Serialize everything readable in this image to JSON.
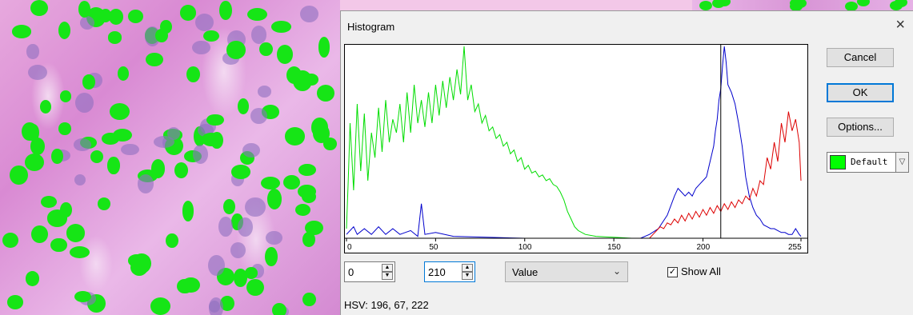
{
  "dialog": {
    "title": "Histogram",
    "close_glyph": "×"
  },
  "buttons": {
    "cancel": "Cancel",
    "ok": "OK",
    "options": "Options..."
  },
  "color_select": {
    "value": "Default",
    "swatch_color": "#00ff00"
  },
  "controls": {
    "low_value": "0",
    "high_value": "210",
    "channel": "Value",
    "show_all_label": "Show All",
    "show_all_checked": true
  },
  "status": {
    "text": "HSV: 196, 67, 222"
  },
  "chart_data": {
    "type": "line",
    "x_ticks": [
      "0",
      "50",
      "100",
      "150",
      "200",
      "255"
    ],
    "xlim": [
      0,
      255
    ],
    "ylim": [
      0,
      1
    ],
    "threshold_value": 210,
    "series": [
      {
        "color": "#00dd00",
        "points": [
          [
            0,
            0.05
          ],
          [
            1,
            0.3
          ],
          [
            2,
            0.6
          ],
          [
            4,
            0.25
          ],
          [
            6,
            0.7
          ],
          [
            8,
            0.35
          ],
          [
            10,
            0.65
          ],
          [
            12,
            0.3
          ],
          [
            14,
            0.55
          ],
          [
            16,
            0.42
          ],
          [
            18,
            0.68
          ],
          [
            20,
            0.45
          ],
          [
            22,
            0.72
          ],
          [
            24,
            0.5
          ],
          [
            26,
            0.62
          ],
          [
            28,
            0.55
          ],
          [
            30,
            0.7
          ],
          [
            32,
            0.5
          ],
          [
            34,
            0.76
          ],
          [
            36,
            0.55
          ],
          [
            38,
            0.8
          ],
          [
            40,
            0.6
          ],
          [
            42,
            0.72
          ],
          [
            44,
            0.58
          ],
          [
            46,
            0.76
          ],
          [
            48,
            0.6
          ],
          [
            50,
            0.8
          ],
          [
            52,
            0.64
          ],
          [
            54,
            0.82
          ],
          [
            56,
            0.68
          ],
          [
            58,
            0.84
          ],
          [
            60,
            0.72
          ],
          [
            62,
            0.88
          ],
          [
            64,
            0.75
          ],
          [
            66,
            1.0
          ],
          [
            68,
            0.72
          ],
          [
            70,
            0.8
          ],
          [
            72,
            0.66
          ],
          [
            74,
            0.7
          ],
          [
            76,
            0.6
          ],
          [
            78,
            0.64
          ],
          [
            80,
            0.56
          ],
          [
            82,
            0.58
          ],
          [
            84,
            0.52
          ],
          [
            86,
            0.54
          ],
          [
            88,
            0.48
          ],
          [
            90,
            0.5
          ],
          [
            92,
            0.44
          ],
          [
            94,
            0.46
          ],
          [
            96,
            0.4
          ],
          [
            98,
            0.42
          ],
          [
            100,
            0.36
          ],
          [
            102,
            0.38
          ],
          [
            104,
            0.34
          ],
          [
            106,
            0.35
          ],
          [
            108,
            0.32
          ],
          [
            110,
            0.33
          ],
          [
            112,
            0.3
          ],
          [
            114,
            0.31
          ],
          [
            116,
            0.28
          ],
          [
            118,
            0.27
          ],
          [
            120,
            0.24
          ],
          [
            122,
            0.2
          ],
          [
            124,
            0.14
          ],
          [
            126,
            0.1
          ],
          [
            128,
            0.06
          ],
          [
            130,
            0.04
          ],
          [
            134,
            0.02
          ],
          [
            140,
            0.01
          ],
          [
            150,
            0.005
          ],
          [
            160,
            0.0
          ],
          [
            255,
            0.0
          ]
        ]
      },
      {
        "color": "#0000cc",
        "points": [
          [
            0,
            0.02
          ],
          [
            4,
            0.06
          ],
          [
            6,
            0.02
          ],
          [
            10,
            0.05
          ],
          [
            14,
            0.02
          ],
          [
            18,
            0.06
          ],
          [
            22,
            0.02
          ],
          [
            26,
            0.05
          ],
          [
            30,
            0.02
          ],
          [
            36,
            0.04
          ],
          [
            40,
            0.01
          ],
          [
            42,
            0.18
          ],
          [
            44,
            0.02
          ],
          [
            50,
            0.03
          ],
          [
            60,
            0.01
          ],
          [
            100,
            0.0
          ],
          [
            165,
            0.0
          ],
          [
            170,
            0.02
          ],
          [
            175,
            0.05
          ],
          [
            180,
            0.12
          ],
          [
            184,
            0.22
          ],
          [
            186,
            0.26
          ],
          [
            188,
            0.24
          ],
          [
            190,
            0.22
          ],
          [
            192,
            0.24
          ],
          [
            194,
            0.22
          ],
          [
            196,
            0.26
          ],
          [
            198,
            0.28
          ],
          [
            200,
            0.3
          ],
          [
            202,
            0.32
          ],
          [
            204,
            0.4
          ],
          [
            206,
            0.48
          ],
          [
            207,
            0.56
          ],
          [
            208,
            0.62
          ],
          [
            209,
            0.72
          ],
          [
            210,
            0.78
          ],
          [
            211,
            0.9
          ],
          [
            212,
            1.0
          ],
          [
            213,
            0.92
          ],
          [
            214,
            0.8
          ],
          [
            216,
            0.76
          ],
          [
            218,
            0.7
          ],
          [
            220,
            0.6
          ],
          [
            222,
            0.48
          ],
          [
            224,
            0.32
          ],
          [
            226,
            0.22
          ],
          [
            228,
            0.16
          ],
          [
            230,
            0.12
          ],
          [
            232,
            0.1
          ],
          [
            234,
            0.07
          ],
          [
            236,
            0.06
          ],
          [
            238,
            0.05
          ],
          [
            240,
            0.05
          ],
          [
            242,
            0.04
          ],
          [
            244,
            0.03
          ],
          [
            246,
            0.03
          ],
          [
            248,
            0.02
          ],
          [
            250,
            0.02
          ],
          [
            252,
            0.05
          ],
          [
            254,
            0.02
          ],
          [
            255,
            0.01
          ]
        ]
      },
      {
        "color": "#dd0000",
        "points": [
          [
            0,
            0.0
          ],
          [
            170,
            0.0
          ],
          [
            172,
            0.02
          ],
          [
            174,
            0.04
          ],
          [
            176,
            0.06
          ],
          [
            178,
            0.05
          ],
          [
            180,
            0.08
          ],
          [
            182,
            0.07
          ],
          [
            184,
            0.1
          ],
          [
            186,
            0.08
          ],
          [
            188,
            0.12
          ],
          [
            190,
            0.09
          ],
          [
            192,
            0.13
          ],
          [
            194,
            0.1
          ],
          [
            196,
            0.14
          ],
          [
            198,
            0.11
          ],
          [
            200,
            0.15
          ],
          [
            202,
            0.12
          ],
          [
            204,
            0.16
          ],
          [
            206,
            0.13
          ],
          [
            208,
            0.17
          ],
          [
            210,
            0.14
          ],
          [
            212,
            0.18
          ],
          [
            214,
            0.15
          ],
          [
            216,
            0.19
          ],
          [
            218,
            0.16
          ],
          [
            220,
            0.2
          ],
          [
            222,
            0.18
          ],
          [
            224,
            0.22
          ],
          [
            226,
            0.2
          ],
          [
            228,
            0.26
          ],
          [
            230,
            0.22
          ],
          [
            232,
            0.3
          ],
          [
            234,
            0.28
          ],
          [
            236,
            0.42
          ],
          [
            238,
            0.36
          ],
          [
            240,
            0.5
          ],
          [
            242,
            0.4
          ],
          [
            244,
            0.6
          ],
          [
            246,
            0.5
          ],
          [
            248,
            0.66
          ],
          [
            250,
            0.56
          ],
          [
            252,
            0.62
          ],
          [
            254,
            0.5
          ],
          [
            255,
            0.3
          ]
        ]
      }
    ]
  }
}
